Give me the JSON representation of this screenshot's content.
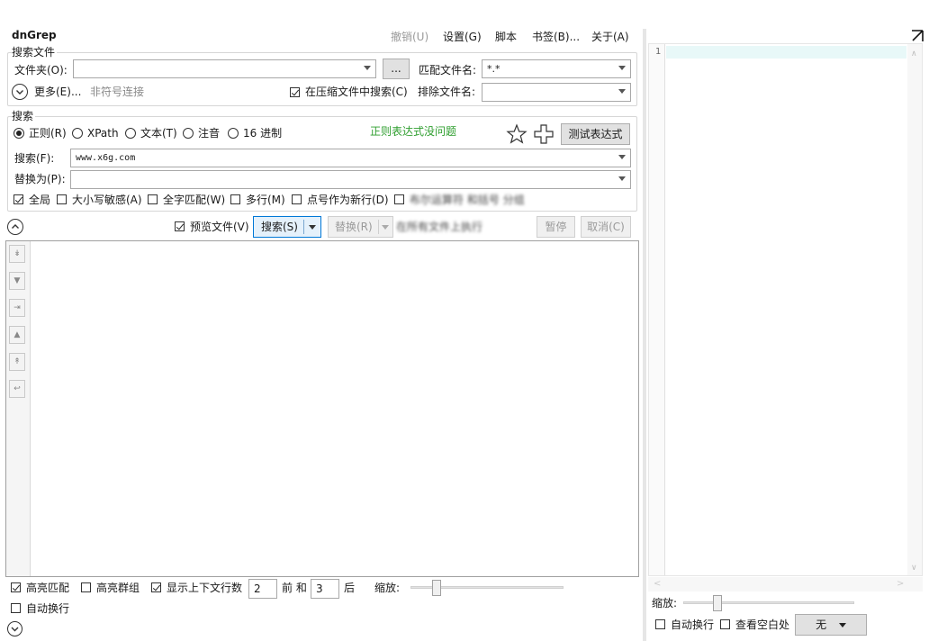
{
  "app": {
    "title": "dnGrep"
  },
  "menu": [
    {
      "label": "撤销(U)",
      "disabled": true
    },
    {
      "label": "设置(G)",
      "disabled": false
    },
    {
      "label": "脚本",
      "disabled": false
    },
    {
      "label": "书签(B)...",
      "disabled": false
    },
    {
      "label": "关于(A)",
      "disabled": false
    }
  ],
  "search_files": {
    "group_label": "搜索文件",
    "folder_label": "文件夹(O):",
    "folder_value": "",
    "browse_label": "...",
    "match_name_label": "匹配文件名:",
    "match_name_value": "*.*",
    "more_label": "更多(E)...",
    "unsymlink_label": "非符号连接",
    "archive_label": "在压缩文件中搜索(C)",
    "archive_checked": true,
    "exclude_label": "排除文件名:",
    "exclude_value": ""
  },
  "search": {
    "group_label": "搜索",
    "modes": [
      {
        "label": "正则(R)",
        "checked": true
      },
      {
        "label": "XPath",
        "checked": false
      },
      {
        "label": "文本(T)",
        "checked": false
      },
      {
        "label": "注音",
        "checked": false
      },
      {
        "label": "16 进制",
        "checked": false
      }
    ],
    "regex_status": "正则表达式没问题",
    "test_label": "测试表达式",
    "search_label": "搜索(F):",
    "search_value": "www.x6g.com",
    "replace_label": "替换为(P):",
    "replace_value": "",
    "options": [
      {
        "label": "全局",
        "checked": true
      },
      {
        "label": "大小写敏感(A)",
        "checked": false
      },
      {
        "label": "全字匹配(W)",
        "checked": false
      },
      {
        "label": "多行(M)",
        "checked": false
      },
      {
        "label": "点号作为新行(D)",
        "checked": false
      }
    ],
    "blurred_option": "布尔运算符 和括号 分组"
  },
  "actions": {
    "preview_label": "预览文件(V)",
    "preview_checked": true,
    "search_button": "搜索(S)",
    "replace_button": "替换(R)",
    "blurred_action": "在所有文件上执行",
    "pause_button": "暂停",
    "cancel_button": "取消(C)"
  },
  "bottom": {
    "highlight_label": "高亮匹配",
    "highlight_checked": true,
    "group_label": "高亮群组",
    "group_checked": false,
    "context_label": "显示上下文行数",
    "context_checked": true,
    "before_value": "2",
    "before_label": "前 和",
    "after_value": "3",
    "after_label": "后",
    "zoom_label": "缩放:",
    "zoom_level": 0.17,
    "wrap_label": "自动换行",
    "wrap_checked": false
  },
  "preview": {
    "line_number": "1",
    "zoom_label": "缩放:",
    "zoom_level": 0.2,
    "wrap_label": "自动换行",
    "whitespace_label": "查看空白处",
    "syntax_value": "无"
  },
  "colors": {
    "status_green": "#2e9e2e",
    "line_highlight": "#e8f8f8"
  }
}
